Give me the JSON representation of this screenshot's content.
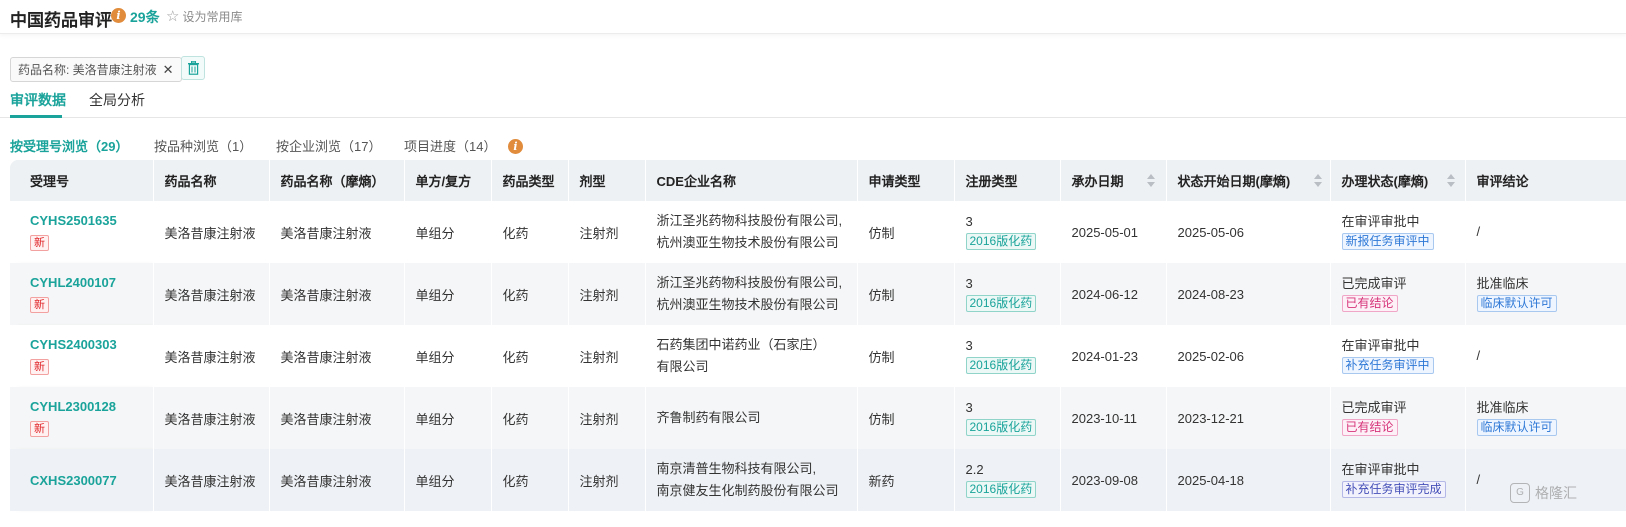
{
  "header": {
    "title": "中国药品审评",
    "count": "29条",
    "favorite_label": "设为常用库"
  },
  "filter": {
    "chip_label": "药品名称: 美洛昔康注射液",
    "remove_symbol": "✕"
  },
  "tabs": [
    {
      "label": "审评数据",
      "active": true
    },
    {
      "label": "全局分析",
      "active": false
    }
  ],
  "subtabs": [
    {
      "label": "按受理号浏览（29）",
      "active": true
    },
    {
      "label": "按品种浏览（1）",
      "active": false
    },
    {
      "label": "按企业浏览（17）",
      "active": false
    },
    {
      "label": "项目进度（14）",
      "active": false
    }
  ],
  "table": {
    "columns": [
      "受理号",
      "药品名称",
      "药品名称（摩熵）",
      "单方/复方",
      "药品类型",
      "剂型",
      "CDE企业名称",
      "申请类型",
      "注册类型",
      "承办日期",
      "状态开始日期(摩熵)",
      "办理状态(摩熵)",
      "审评结论"
    ],
    "rows": [
      {
        "acceptance_no": "CYHS2501635",
        "badge": "新",
        "drug_name": "美洛昔康注射液",
        "drug_name_moshang": "美洛昔康注射液",
        "single_compound": "单组分",
        "drug_type": "化药",
        "dosage_form": "注射剂",
        "company_line1": "浙江圣兆药物科技股份有限公司,",
        "company_line2": "杭州澳亚生物技术股份有限公司",
        "apply_type": "仿制",
        "reg_class": "3",
        "reg_tag": "2016版化药",
        "accept_date": "2025-05-01",
        "status_date": "2025-05-06",
        "status": "在审评审批中",
        "status_tag": "新报任务审评中",
        "conclusion": "/",
        "conclusion_tag": ""
      },
      {
        "acceptance_no": "CYHL2400107",
        "badge": "新",
        "drug_name": "美洛昔康注射液",
        "drug_name_moshang": "美洛昔康注射液",
        "single_compound": "单组分",
        "drug_type": "化药",
        "dosage_form": "注射剂",
        "company_line1": "浙江圣兆药物科技股份有限公司,",
        "company_line2": "杭州澳亚生物技术股份有限公司",
        "apply_type": "仿制",
        "reg_class": "3",
        "reg_tag": "2016版化药",
        "accept_date": "2024-06-12",
        "status_date": "2024-08-23",
        "status": "已完成审评",
        "status_tag": "已有结论",
        "conclusion": "批准临床",
        "conclusion_tag": "临床默认许可"
      },
      {
        "acceptance_no": "CYHS2400303",
        "badge": "新",
        "drug_name": "美洛昔康注射液",
        "drug_name_moshang": "美洛昔康注射液",
        "single_compound": "单组分",
        "drug_type": "化药",
        "dosage_form": "注射剂",
        "company_line1": "石药集团中诺药业（石家庄）",
        "company_line2": "有限公司",
        "apply_type": "仿制",
        "reg_class": "3",
        "reg_tag": "2016版化药",
        "accept_date": "2024-01-23",
        "status_date": "2025-02-06",
        "status": "在审评审批中",
        "status_tag": "补充任务审评中",
        "conclusion": "/",
        "conclusion_tag": ""
      },
      {
        "acceptance_no": "CYHL2300128",
        "badge": "新",
        "drug_name": "美洛昔康注射液",
        "drug_name_moshang": "美洛昔康注射液",
        "single_compound": "单组分",
        "drug_type": "化药",
        "dosage_form": "注射剂",
        "company_line1": "齐鲁制药有限公司",
        "company_line2": "",
        "apply_type": "仿制",
        "reg_class": "3",
        "reg_tag": "2016版化药",
        "accept_date": "2023-10-11",
        "status_date": "2023-12-21",
        "status": "已完成审评",
        "status_tag": "已有结论",
        "conclusion": "批准临床",
        "conclusion_tag": "临床默认许可"
      },
      {
        "acceptance_no": "CXHS2300077",
        "badge": "",
        "drug_name": "美洛昔康注射液",
        "drug_name_moshang": "美洛昔康注射液",
        "single_compound": "单组分",
        "drug_type": "化药",
        "dosage_form": "注射剂",
        "company_line1": "南京清普生物科技有限公司,",
        "company_line2": "南京健友生化制药股份有限公司",
        "apply_type": "新药",
        "reg_class": "2.2",
        "reg_tag": "2016版化药",
        "accept_date": "2023-09-08",
        "status_date": "2025-04-18",
        "status": "在审评审批中",
        "status_tag": "补充任务审评完成",
        "conclusion": "/",
        "conclusion_tag": ""
      }
    ]
  },
  "watermark": "格隆汇",
  "colors": {
    "accent": "#1aa39a",
    "info_icon": "#e08c3c",
    "new_badge": "#e0262a",
    "tag_pink": "#d6337a",
    "tag_blue": "#2e78d6",
    "tag_indigo": "#4650b8"
  },
  "icons": [
    "info-icon",
    "star-icon",
    "close-icon",
    "trash-icon",
    "sort-icon",
    "watermark-logo-icon"
  ]
}
